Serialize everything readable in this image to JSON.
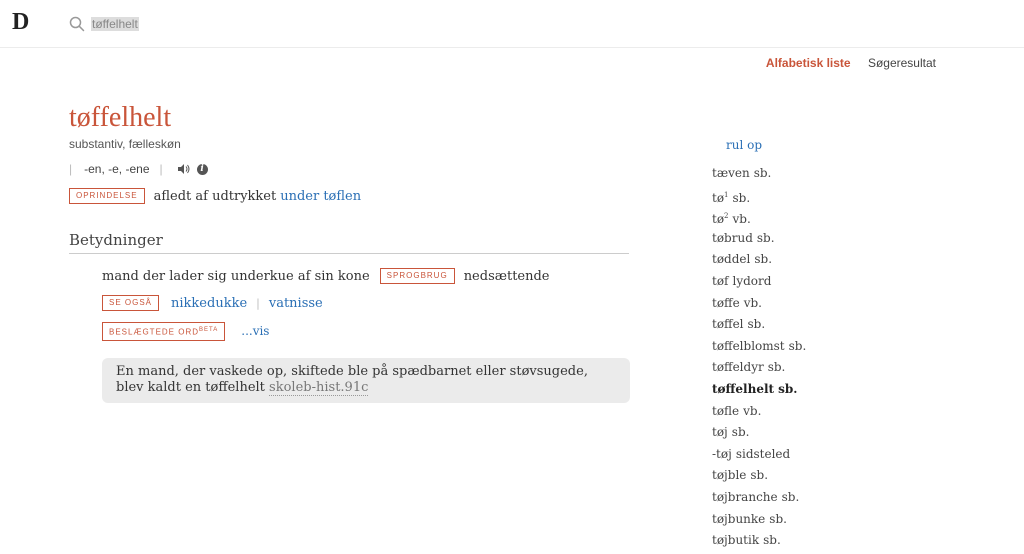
{
  "logo": "D",
  "search": {
    "value": "tøffelhelt",
    "placeholder": ""
  },
  "view_tabs": {
    "active": "Alfabetisk liste",
    "inactive": "Søgeresultat"
  },
  "entry": {
    "headword": "tøffelhelt",
    "pos": "substantiv, fælleskøn",
    "inflection": "-en, -e, -ene",
    "origin": {
      "tag": "OPRINDELSE",
      "text": "afledt af udtrykket",
      "link": "under tøflen"
    },
    "section_title": "Betydninger",
    "definition": {
      "text": "mand der lader sig underkue af sin kone",
      "tag": "SPROGBRUG",
      "usage": "nedsættende"
    },
    "see_also": {
      "tag": "SE OGSÅ",
      "links": [
        "nikkedukke",
        "vatnisse"
      ]
    },
    "related": {
      "tag": "BESLÆGTEDE ORD",
      "tag_sup": "BETA",
      "link": "...vis"
    },
    "quote": {
      "text": "En mand, der vaskede op, skiftede ble på spædbarnet eller støvsugede, blev kaldt en tøffelhelt",
      "source": "skoleb-hist.91c"
    }
  },
  "sidebar": {
    "scroll_up": "rul op",
    "words": [
      {
        "word": "tæven",
        "sup": "",
        "pos": "sb."
      },
      {
        "word": "tø",
        "sup": "1",
        "pos": "sb."
      },
      {
        "word": "tø",
        "sup": "2",
        "pos": "vb."
      },
      {
        "word": "tøbrud",
        "sup": "",
        "pos": "sb."
      },
      {
        "word": "tøddel",
        "sup": "",
        "pos": "sb."
      },
      {
        "word": "tøf",
        "sup": "",
        "pos": "lydord"
      },
      {
        "word": "tøffe",
        "sup": "",
        "pos": "vb."
      },
      {
        "word": "tøffel",
        "sup": "",
        "pos": "sb."
      },
      {
        "word": "tøffelblomst",
        "sup": "",
        "pos": "sb."
      },
      {
        "word": "tøffeldyr",
        "sup": "",
        "pos": "sb."
      },
      {
        "word": "tøffelhelt",
        "sup": "",
        "pos": "sb.",
        "current": true
      },
      {
        "word": "tøfle",
        "sup": "",
        "pos": "vb."
      },
      {
        "word": "tøj",
        "sup": "",
        "pos": "sb."
      },
      {
        "word": "-tøj",
        "sup": "",
        "pos": "sidsteled"
      },
      {
        "word": "tøjble",
        "sup": "",
        "pos": "sb."
      },
      {
        "word": "tøjbranche",
        "sup": "",
        "pos": "sb."
      },
      {
        "word": "tøjbunke",
        "sup": "",
        "pos": "sb."
      },
      {
        "word": "tøjbutik",
        "sup": "",
        "pos": "sb."
      }
    ]
  },
  "colors": {
    "accent": "#c9553a",
    "link": "#2a6fb5"
  }
}
